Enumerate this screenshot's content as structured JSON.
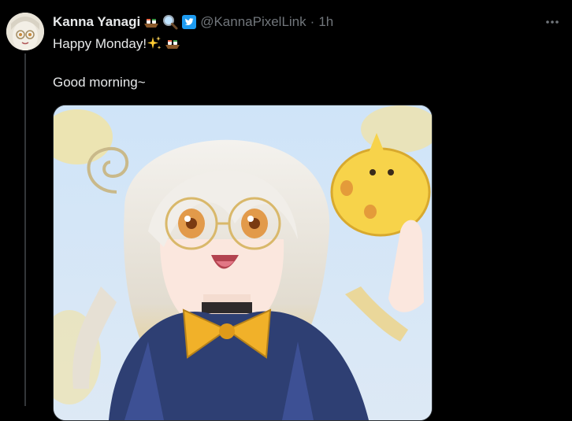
{
  "tweet": {
    "author_name": "Kanna Yanagi",
    "handle": "@KannaPixelLink",
    "separator": "·",
    "time": "1h",
    "line1_text": "Happy Monday!",
    "line2_text": "Good morning~",
    "name_emojis": [
      "sushi-boat-icon",
      "magnifier-icon"
    ],
    "line1_emojis": [
      "sparkles-icon",
      "sushi-boat-icon"
    ],
    "verified_badge": "bird-verified-icon",
    "more_icon": "more-dots-icon",
    "media_alt": "Anime illustration of a girl with silver hair and glasses"
  },
  "colors": {
    "background": "#000000",
    "text": "#e7e9ea",
    "muted": "#71767b",
    "verified_blue": "#1d9bf0"
  }
}
